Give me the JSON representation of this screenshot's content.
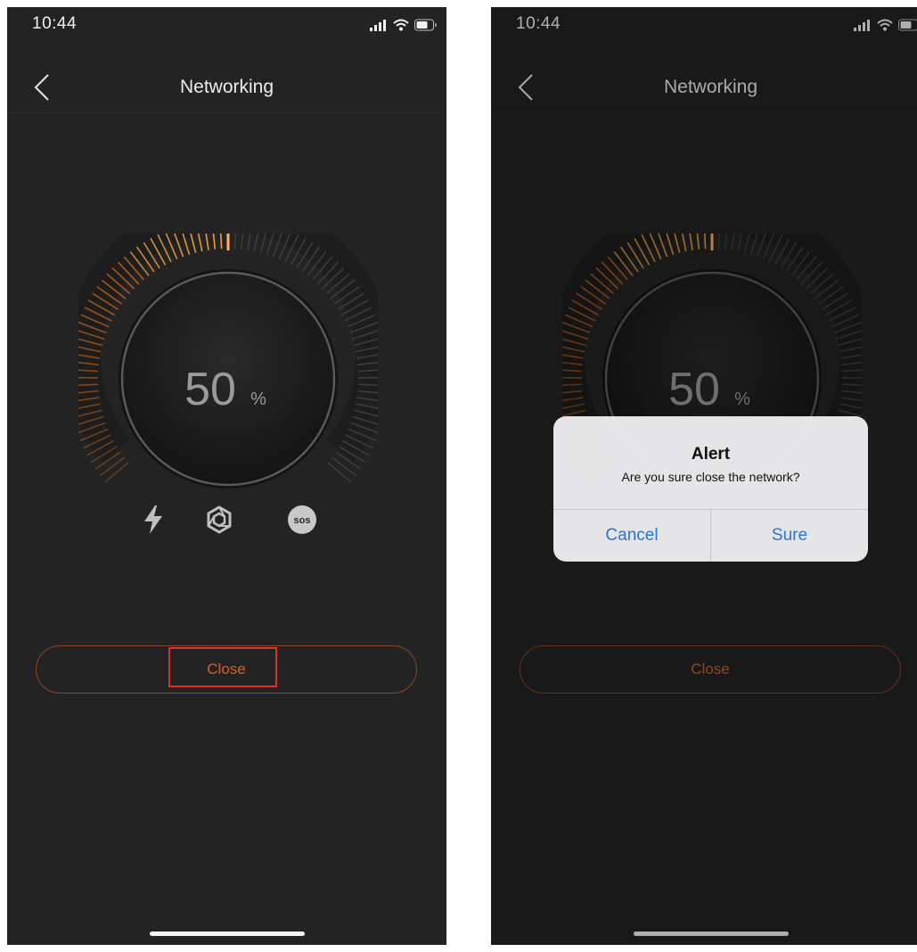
{
  "colors": {
    "background": "#232323",
    "accent": "#d2602a",
    "alert_button": "#2f72d8"
  },
  "screens": [
    {
      "status_time": "10:44",
      "title": "Networking",
      "gauge": {
        "value": 50,
        "value_text": "50",
        "unit": "%"
      },
      "modes": [
        {
          "icon": "lightning-icon"
        },
        {
          "icon": "hexagon-link-icon"
        },
        {
          "icon": "sos-icon",
          "label": "sos"
        }
      ],
      "close_label": "Close"
    },
    {
      "status_time": "10:44",
      "title": "Networking",
      "gauge": {
        "value": 50,
        "value_text": "50",
        "unit": "%"
      },
      "close_label": "Close",
      "alert": {
        "title": "Alert",
        "message": "Are you sure close the network?",
        "cancel_label": "Cancel",
        "confirm_label": "Sure"
      }
    }
  ]
}
